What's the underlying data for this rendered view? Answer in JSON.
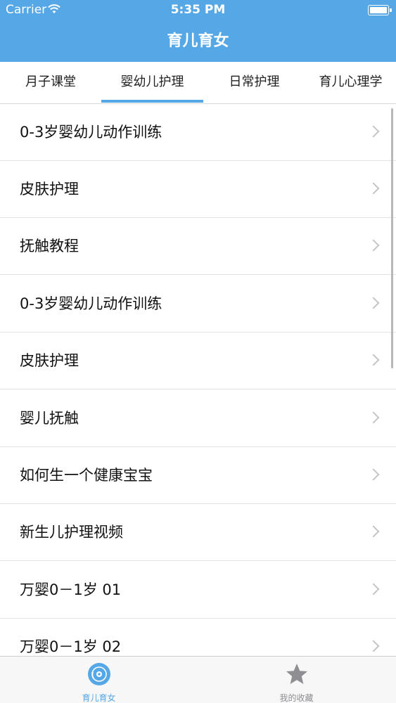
{
  "status_bar": {
    "carrier": "Carrier",
    "time": "5:35 PM"
  },
  "nav": {
    "title": "育儿育女"
  },
  "tabs": [
    {
      "label": "月子课堂",
      "selected": false
    },
    {
      "label": "婴幼儿护理",
      "selected": true
    },
    {
      "label": "日常护理",
      "selected": false
    },
    {
      "label": "育儿心理学",
      "selected": false
    }
  ],
  "list": [
    {
      "label": "0-3岁婴幼儿动作训练"
    },
    {
      "label": "皮肤护理"
    },
    {
      "label": "抚触教程"
    },
    {
      "label": "0-3岁婴幼儿动作训练"
    },
    {
      "label": "皮肤护理"
    },
    {
      "label": "婴儿抚触"
    },
    {
      "label": "如何生一个健康宝宝"
    },
    {
      "label": "新生儿护理视频"
    },
    {
      "label": "万婴0－1岁 01"
    },
    {
      "label": "万婴0－1岁 02"
    }
  ],
  "tabbar": [
    {
      "label": "育儿育女",
      "icon": "disc-icon",
      "selected": true
    },
    {
      "label": "我的收藏",
      "icon": "star-icon",
      "selected": false
    }
  ],
  "colors": {
    "accent": "#55a7e6",
    "inactive_tab": "#8e8e93"
  }
}
